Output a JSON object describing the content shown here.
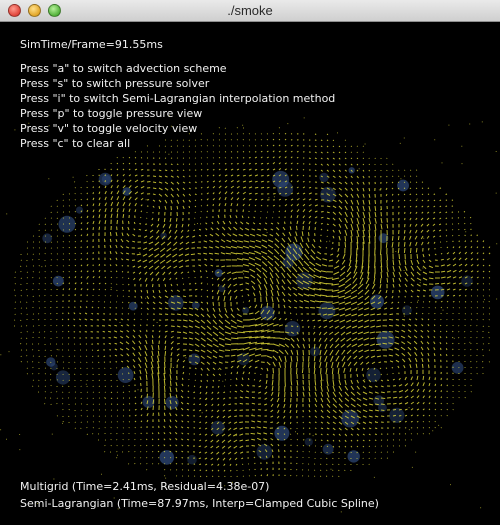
{
  "window": {
    "title": "./smoke"
  },
  "hud": {
    "sim_time": "SimTime/Frame=91.55ms",
    "instructions": [
      "Press \"a\" to switch advection scheme",
      "Press \"s\" to switch pressure solver",
      "Press \"i\" to switch Semi-Lagrangian interpolation method",
      "Press \"p\" to toggle pressure view",
      "Press \"v\" to toggle velocity view",
      "Press \"c\" to clear all"
    ],
    "pressure_solver": "Multigrid (Time=2.41ms, Residual=4.38e-07)",
    "advection": "Semi-Lagrangian (Time=87.97ms, Interp=Clamped Cubic Spline)"
  },
  "colors": {
    "background": "#000000",
    "velocity": "#e8e23a",
    "smoke": "#2f4a7a",
    "text": "#f2f2f2"
  }
}
